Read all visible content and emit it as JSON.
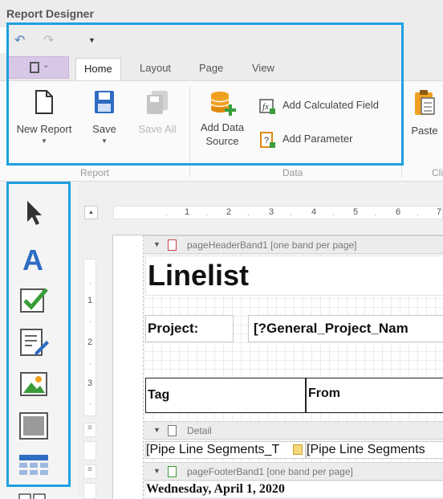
{
  "window": {
    "title": "Report Designer"
  },
  "quick_access": {
    "undo_icon": "undo-icon",
    "redo_icon": "redo-icon",
    "customize_icon": "dropdown-arrow-icon"
  },
  "tabs": [
    {
      "label": "Home",
      "active": true
    },
    {
      "label": "Layout",
      "active": false
    },
    {
      "label": "Page",
      "active": false
    },
    {
      "label": "View",
      "active": false
    }
  ],
  "ribbon": {
    "report_group": {
      "label": "Report",
      "new_report": "New Report",
      "save": "Save",
      "save_all": "Save All"
    },
    "data_group": {
      "label": "Data",
      "add_data_source": "Add Data\nSource",
      "add_calculated_field": "Add Calculated Field",
      "add_parameter": "Add Parameter"
    },
    "clipboard_group": {
      "label": "Cli",
      "paste": "Paste"
    }
  },
  "toolbox": {
    "tools": [
      "pointer-icon",
      "label-icon",
      "checkbox-icon",
      "rich-text-icon",
      "picture-box-icon",
      "panel-icon",
      "table-icon"
    ]
  },
  "ruler": {
    "horizontal": [
      "1",
      "2",
      "3",
      "4",
      "5",
      "6",
      "7"
    ],
    "vertical": [
      "1",
      "2",
      "3"
    ]
  },
  "report": {
    "page_header_band": "pageHeaderBand1 [one band per page]",
    "title": "Linelist",
    "project_label": "Project:",
    "project_value": "[?General_Project_Nam",
    "col_tag": "Tag",
    "col_from": "From",
    "detail_band": "Detail",
    "detail_cell_1": "[Pipe Line Segments_T",
    "detail_cell_2": "[Pipe Line Segments",
    "page_footer_band": "pageFooterBand1 [one band per page]",
    "footer_date": "Wednesday, April 1, 2020"
  },
  "colors": {
    "highlight": "#1ea0e0",
    "accent_blue": "#2e6cc4",
    "accent_green": "#3a9d3a",
    "accent_orange": "#f0a020"
  }
}
